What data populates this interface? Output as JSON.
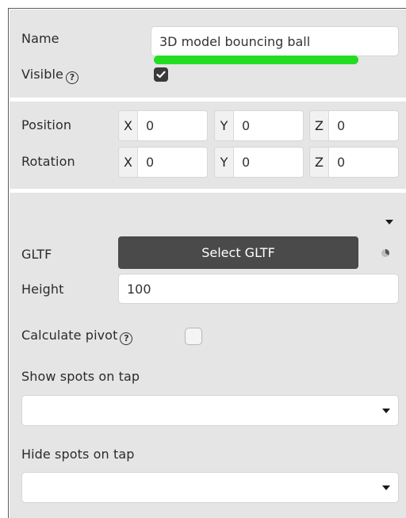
{
  "general": {
    "name_label": "Name",
    "name_value": "3D model bouncing ball",
    "visible_label": "Visible",
    "visible_checked": true,
    "help_glyph": "?"
  },
  "transform": {
    "position_label": "Position",
    "rotation_label": "Rotation",
    "axes": [
      "X",
      "Y",
      "Z"
    ],
    "position": {
      "x": "0",
      "y": "0",
      "z": "0"
    },
    "rotation": {
      "x": "0",
      "y": "0",
      "z": "0"
    }
  },
  "model": {
    "gltf_label": "GLTF",
    "select_gltf_button": "Select GLTF",
    "height_label": "Height",
    "height_value": "100",
    "calculate_pivot_label": "Calculate pivot",
    "calculate_pivot_checked": false,
    "show_spots_label": "Show spots on tap",
    "show_spots_value": "",
    "hide_spots_label": "Hide spots on tap",
    "hide_spots_value": ""
  },
  "colors": {
    "panel_bg": "#e5e5e5",
    "button_bg": "#4a4a4a",
    "highlight": "#22dd22"
  }
}
